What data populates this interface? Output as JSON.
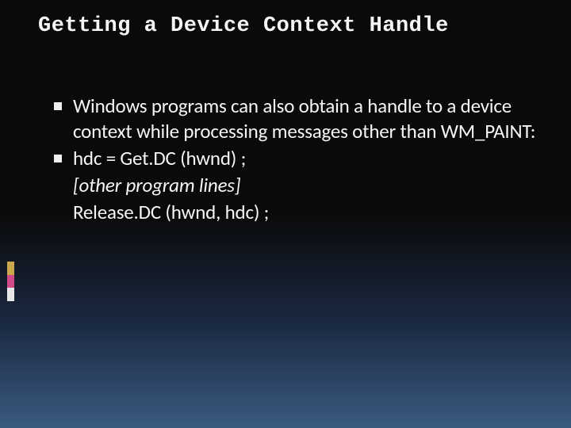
{
  "slide": {
    "title": "Getting a Device Context Handle",
    "bullets": [
      {
        "text": "Windows programs can also obtain a handle to a device context while processing messages other than WM_PAINT:",
        "marker": true,
        "italic": false
      },
      {
        "text": "hdc = Get.DC (hwnd) ;",
        "marker": true,
        "italic": false
      },
      {
        "text": "[other program lines]",
        "marker": false,
        "italic": true
      },
      {
        "text": "Release.DC (hwnd, hdc) ;",
        "marker": false,
        "italic": false
      }
    ]
  }
}
